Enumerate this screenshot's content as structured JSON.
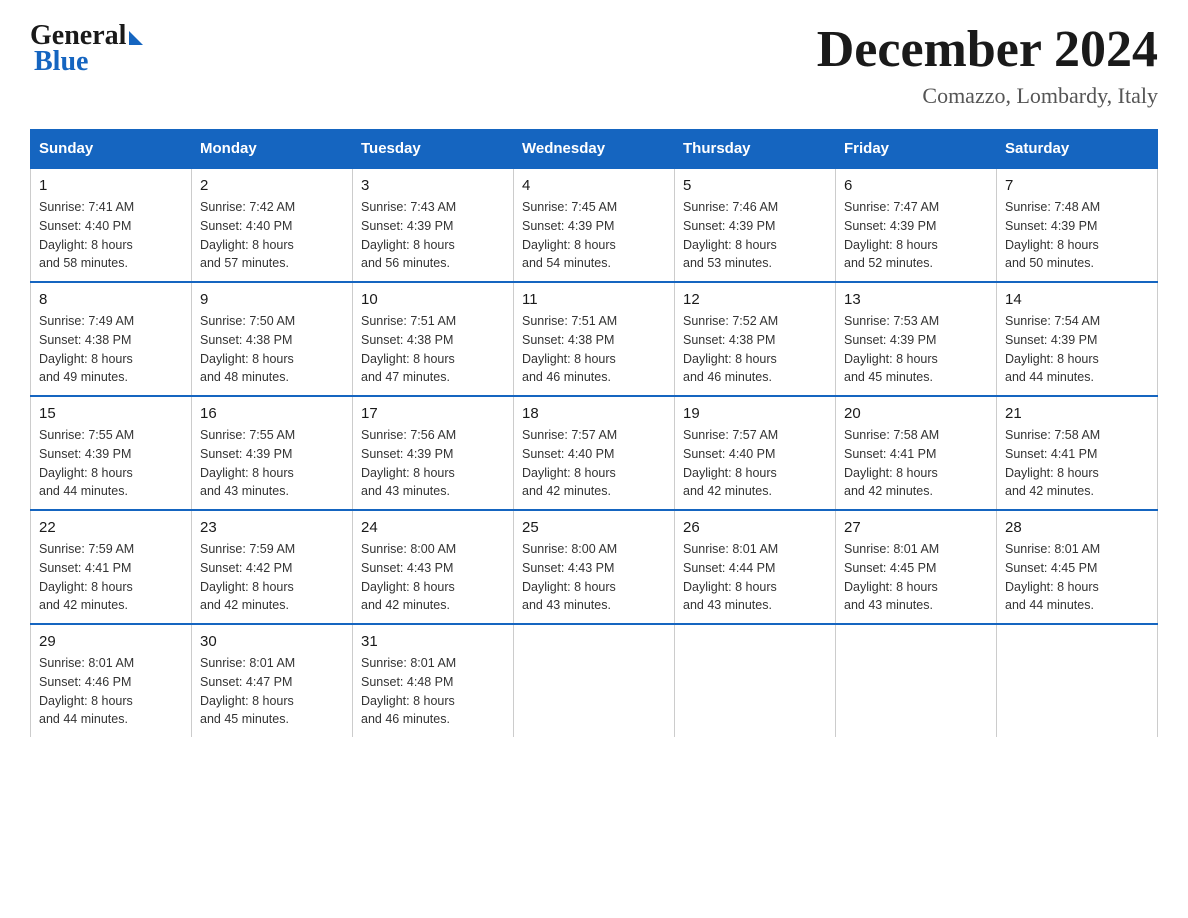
{
  "header": {
    "logo_general": "General",
    "logo_blue": "Blue",
    "month_title": "December 2024",
    "location": "Comazzo, Lombardy, Italy"
  },
  "days_of_week": [
    "Sunday",
    "Monday",
    "Tuesday",
    "Wednesday",
    "Thursday",
    "Friday",
    "Saturday"
  ],
  "weeks": [
    [
      {
        "day": "1",
        "sunrise": "7:41 AM",
        "sunset": "4:40 PM",
        "daylight": "8 hours and 58 minutes."
      },
      {
        "day": "2",
        "sunrise": "7:42 AM",
        "sunset": "4:40 PM",
        "daylight": "8 hours and 57 minutes."
      },
      {
        "day": "3",
        "sunrise": "7:43 AM",
        "sunset": "4:39 PM",
        "daylight": "8 hours and 56 minutes."
      },
      {
        "day": "4",
        "sunrise": "7:45 AM",
        "sunset": "4:39 PM",
        "daylight": "8 hours and 54 minutes."
      },
      {
        "day": "5",
        "sunrise": "7:46 AM",
        "sunset": "4:39 PM",
        "daylight": "8 hours and 53 minutes."
      },
      {
        "day": "6",
        "sunrise": "7:47 AM",
        "sunset": "4:39 PM",
        "daylight": "8 hours and 52 minutes."
      },
      {
        "day": "7",
        "sunrise": "7:48 AM",
        "sunset": "4:39 PM",
        "daylight": "8 hours and 50 minutes."
      }
    ],
    [
      {
        "day": "8",
        "sunrise": "7:49 AM",
        "sunset": "4:38 PM",
        "daylight": "8 hours and 49 minutes."
      },
      {
        "day": "9",
        "sunrise": "7:50 AM",
        "sunset": "4:38 PM",
        "daylight": "8 hours and 48 minutes."
      },
      {
        "day": "10",
        "sunrise": "7:51 AM",
        "sunset": "4:38 PM",
        "daylight": "8 hours and 47 minutes."
      },
      {
        "day": "11",
        "sunrise": "7:51 AM",
        "sunset": "4:38 PM",
        "daylight": "8 hours and 46 minutes."
      },
      {
        "day": "12",
        "sunrise": "7:52 AM",
        "sunset": "4:38 PM",
        "daylight": "8 hours and 46 minutes."
      },
      {
        "day": "13",
        "sunrise": "7:53 AM",
        "sunset": "4:39 PM",
        "daylight": "8 hours and 45 minutes."
      },
      {
        "day": "14",
        "sunrise": "7:54 AM",
        "sunset": "4:39 PM",
        "daylight": "8 hours and 44 minutes."
      }
    ],
    [
      {
        "day": "15",
        "sunrise": "7:55 AM",
        "sunset": "4:39 PM",
        "daylight": "8 hours and 44 minutes."
      },
      {
        "day": "16",
        "sunrise": "7:55 AM",
        "sunset": "4:39 PM",
        "daylight": "8 hours and 43 minutes."
      },
      {
        "day": "17",
        "sunrise": "7:56 AM",
        "sunset": "4:39 PM",
        "daylight": "8 hours and 43 minutes."
      },
      {
        "day": "18",
        "sunrise": "7:57 AM",
        "sunset": "4:40 PM",
        "daylight": "8 hours and 42 minutes."
      },
      {
        "day": "19",
        "sunrise": "7:57 AM",
        "sunset": "4:40 PM",
        "daylight": "8 hours and 42 minutes."
      },
      {
        "day": "20",
        "sunrise": "7:58 AM",
        "sunset": "4:41 PM",
        "daylight": "8 hours and 42 minutes."
      },
      {
        "day": "21",
        "sunrise": "7:58 AM",
        "sunset": "4:41 PM",
        "daylight": "8 hours and 42 minutes."
      }
    ],
    [
      {
        "day": "22",
        "sunrise": "7:59 AM",
        "sunset": "4:41 PM",
        "daylight": "8 hours and 42 minutes."
      },
      {
        "day": "23",
        "sunrise": "7:59 AM",
        "sunset": "4:42 PM",
        "daylight": "8 hours and 42 minutes."
      },
      {
        "day": "24",
        "sunrise": "8:00 AM",
        "sunset": "4:43 PM",
        "daylight": "8 hours and 42 minutes."
      },
      {
        "day": "25",
        "sunrise": "8:00 AM",
        "sunset": "4:43 PM",
        "daylight": "8 hours and 43 minutes."
      },
      {
        "day": "26",
        "sunrise": "8:01 AM",
        "sunset": "4:44 PM",
        "daylight": "8 hours and 43 minutes."
      },
      {
        "day": "27",
        "sunrise": "8:01 AM",
        "sunset": "4:45 PM",
        "daylight": "8 hours and 43 minutes."
      },
      {
        "day": "28",
        "sunrise": "8:01 AM",
        "sunset": "4:45 PM",
        "daylight": "8 hours and 44 minutes."
      }
    ],
    [
      {
        "day": "29",
        "sunrise": "8:01 AM",
        "sunset": "4:46 PM",
        "daylight": "8 hours and 44 minutes."
      },
      {
        "day": "30",
        "sunrise": "8:01 AM",
        "sunset": "4:47 PM",
        "daylight": "8 hours and 45 minutes."
      },
      {
        "day": "31",
        "sunrise": "8:01 AM",
        "sunset": "4:48 PM",
        "daylight": "8 hours and 46 minutes."
      },
      null,
      null,
      null,
      null
    ]
  ]
}
